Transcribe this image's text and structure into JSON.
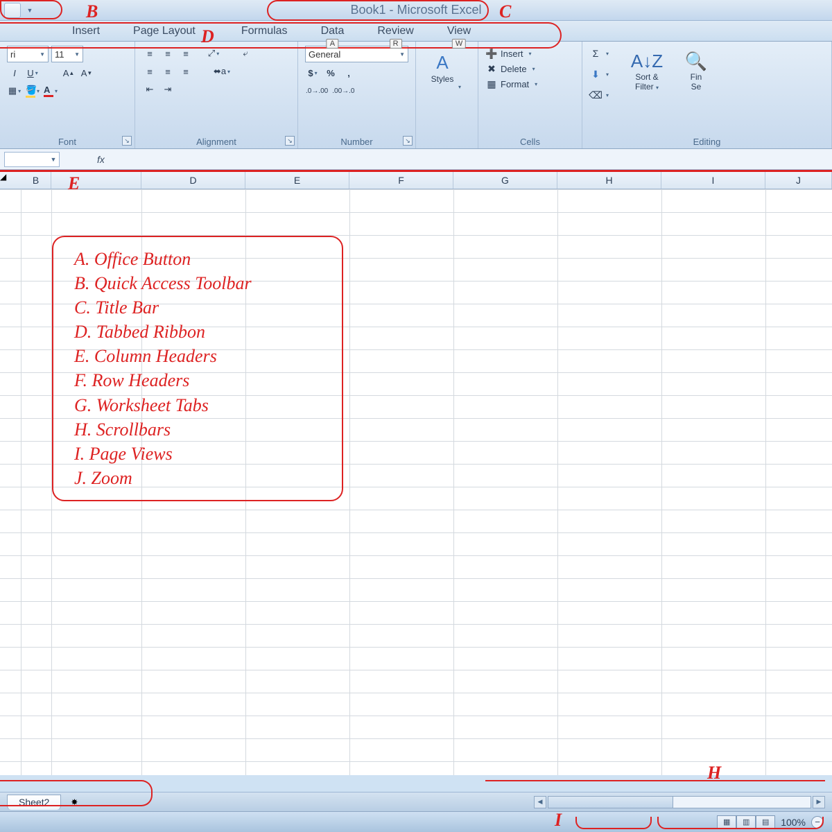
{
  "title": "Book1 - Microsoft Excel",
  "tabs": [
    "Insert",
    "Page Layout",
    "Formulas",
    "Data",
    "Review",
    "View"
  ],
  "key_tips": {
    "data": "A",
    "review": "R",
    "view": "W"
  },
  "font": {
    "name": "ri",
    "size": "11"
  },
  "numfmt": "General",
  "groups": {
    "font": "Font",
    "align": "Alignment",
    "number": "Number",
    "styles": "Styles",
    "cells": "Cells",
    "editing": "Editing"
  },
  "cells": {
    "insert": "Insert",
    "delete": "Delete",
    "format": "Format"
  },
  "editing": {
    "sort": "Sort &",
    "filter": "Filter",
    "find": "Fin",
    "sel": "Se"
  },
  "cols": [
    "B",
    "",
    "D",
    "E",
    "F",
    "G",
    "H",
    "I",
    "J"
  ],
  "sheet_tab": "Sheet2",
  "zoom": "100%",
  "annotations": {
    "B": "B",
    "C": "C",
    "D": "D",
    "E": "E",
    "H": "H",
    "I": "I",
    "list": [
      "A.  Office Button",
      "B.  Quick Access Toolbar",
      "C.  Title Bar",
      "D.  Tabbed Ribbon",
      "E.  Column Headers",
      "F.  Row Headers",
      "G.  Worksheet Tabs",
      "H.  Scrollbars",
      "I.  Page Views",
      "J.  Zoom"
    ]
  },
  "fx_label": "fx"
}
